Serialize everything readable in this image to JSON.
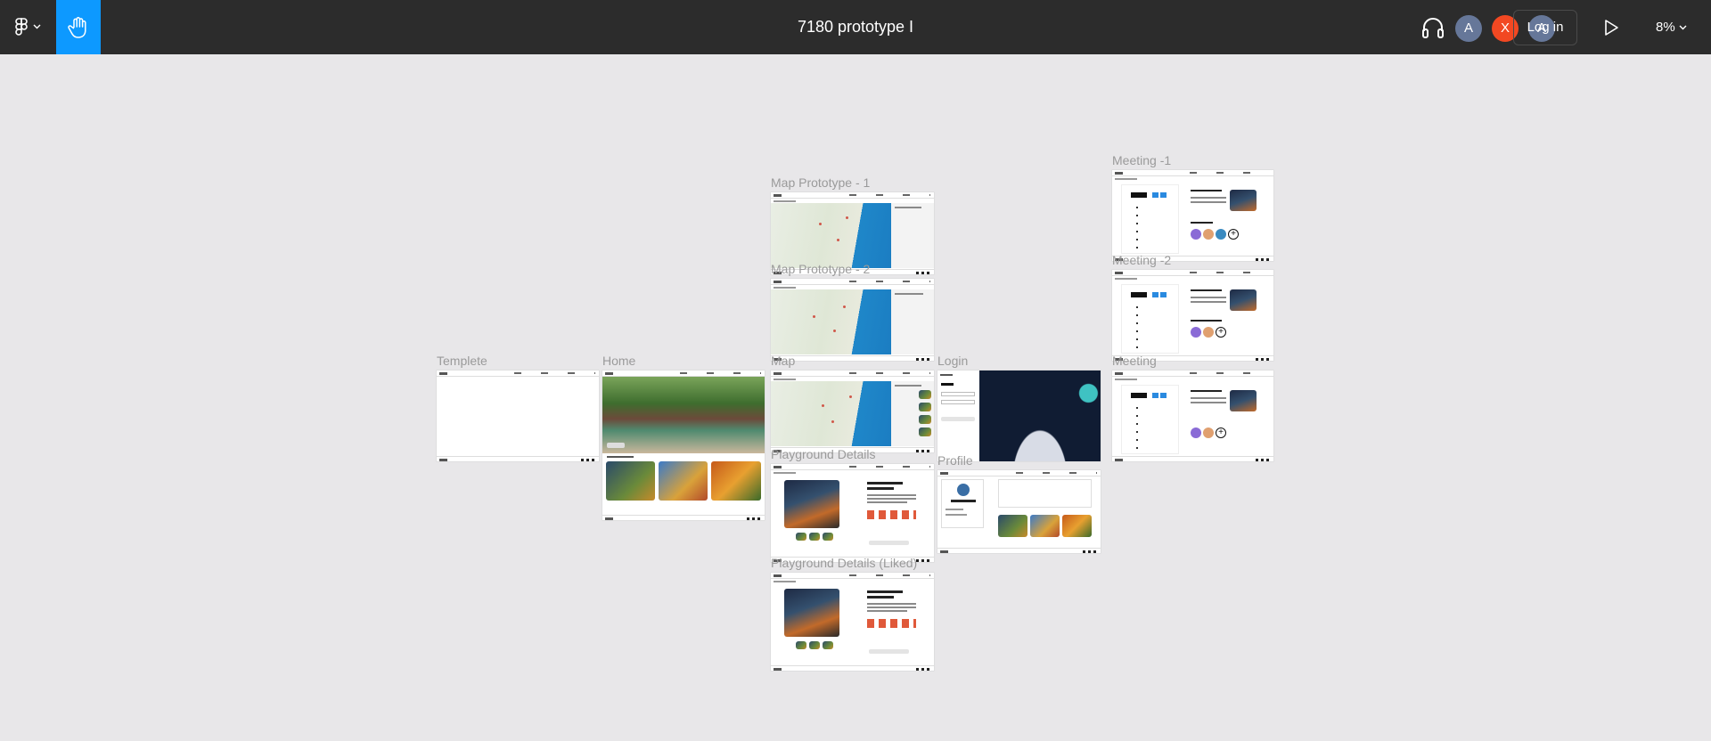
{
  "window": {
    "title": "7180 prototype I"
  },
  "toolbar": {
    "main_menu_icon": "figma-logo-icon",
    "hand_tool_icon": "hand-icon",
    "audio_icon": "headphones-icon",
    "avatars": [
      {
        "initial": "A",
        "color": "#667799"
      },
      {
        "initial": "X",
        "color": "#f24822"
      },
      {
        "initial": "A",
        "color": "#667799"
      }
    ],
    "login_label": "Log in",
    "present_icon": "play-icon",
    "zoom_value": "8%"
  },
  "canvas": {
    "background": "#e8e7e9",
    "frame_labels": {
      "templete": "Templete",
      "home": "Home",
      "map_prototype_1": "Map Prototype - 1",
      "map_prototype_2": "Map Prototype - 2",
      "map": "Map",
      "playground_details": "Playground Details",
      "playground_details_liked": "Playground Details (Liked)",
      "login": "Login",
      "profile": "Profile",
      "meeting_1": "Meeting -1",
      "meeting_2": "Meeting -2",
      "meeting": "Meeting"
    }
  }
}
